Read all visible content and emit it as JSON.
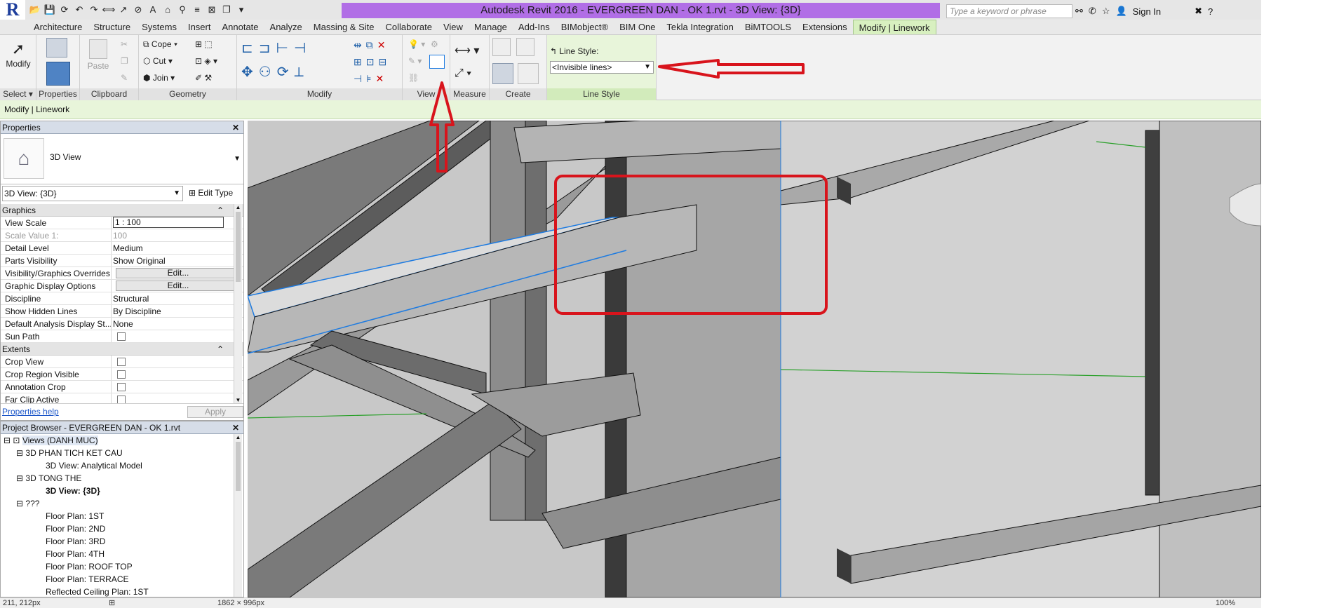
{
  "title": {
    "text": "Autodesk Revit 2016 -     EVERGREEN DAN - OK 1.rvt - 3D View: {3D}"
  },
  "search": {
    "placeholder": "Type a keyword or phrase"
  },
  "account": {
    "sign_in": "Sign In"
  },
  "tabs": [
    "Architecture",
    "Structure",
    "Systems",
    "Insert",
    "Annotate",
    "Analyze",
    "Massing & Site",
    "Collaborate",
    "View",
    "Manage",
    "Add-Ins",
    "BIMobject®",
    "BIM One",
    "Tekla Integration",
    "BiMTOOLS",
    "Extensions",
    "Modify | Linework"
  ],
  "ribbon": {
    "modify_label": "Modify",
    "paste_label": "Paste",
    "cope": "Cope",
    "cut": "Cut",
    "join": "Join",
    "line_style_label": "Line Style:",
    "line_style_value": "<Invisible lines>",
    "groups": {
      "select": "Select",
      "properties": "Properties",
      "clipboard": "Clipboard",
      "geometry": "Geometry",
      "modify": "Modify",
      "view": "View",
      "measure": "Measure",
      "create": "Create",
      "line_style": "Line Style"
    }
  },
  "context_label": "Modify | Linework",
  "properties": {
    "header": "Properties",
    "type_name": "3D View",
    "instance_dropdown": "3D View: {3D}",
    "edit_type": "Edit Type",
    "sections": {
      "graphics": "Graphics",
      "extents": "Extents"
    },
    "graphics_rows": [
      {
        "k": "View Scale",
        "v": "1 : 100"
      },
      {
        "k": "Scale Value    1:",
        "v": "100"
      },
      {
        "k": "Detail Level",
        "v": "Medium"
      },
      {
        "k": "Parts Visibility",
        "v": "Show Original"
      },
      {
        "k": "Visibility/Graphics Overrides",
        "v": "Edit..."
      },
      {
        "k": "Graphic Display Options",
        "v": "Edit..."
      },
      {
        "k": "Discipline",
        "v": "Structural"
      },
      {
        "k": "Show Hidden Lines",
        "v": "By Discipline"
      },
      {
        "k": "Default Analysis Display St...",
        "v": "None"
      },
      {
        "k": "Sun Path",
        "v": ""
      }
    ],
    "extents_rows": [
      {
        "k": "Crop View"
      },
      {
        "k": "Crop Region Visible"
      },
      {
        "k": "Annotation Crop"
      },
      {
        "k": "Far Clip Active"
      }
    ],
    "help": "Properties help",
    "apply": "Apply"
  },
  "browser": {
    "header": "Project Browser - EVERGREEN DAN - OK 1.rvt",
    "items": [
      {
        "label": "Views (DANH MUC)",
        "level": 0
      },
      {
        "label": "3D PHAN TICH KET CAU",
        "level": 1
      },
      {
        "label": "3D View: Analytical Model",
        "level": 2
      },
      {
        "label": "3D TONG THE",
        "level": 1
      },
      {
        "label": "3D View: {3D}",
        "level": 2
      },
      {
        "label": "???",
        "level": 1
      },
      {
        "label": "Floor Plan: 1ST",
        "level": 2
      },
      {
        "label": "Floor Plan: 2ND",
        "level": 2
      },
      {
        "label": "Floor Plan: 3RD",
        "level": 2
      },
      {
        "label": "Floor Plan: 4TH",
        "level": 2
      },
      {
        "label": "Floor Plan: ROOF TOP",
        "level": 2
      },
      {
        "label": "Floor Plan: TERRACE",
        "level": 2
      },
      {
        "label": "Reflected Ceiling Plan: 1ST",
        "level": 2
      }
    ]
  },
  "status": {
    "coords": "211, 212px",
    "size": "1862 × 996px",
    "zoom": "100%"
  },
  "colors": {
    "annotation_red": "#d8141c",
    "ribbon_green": "#d8f0c0",
    "title_purple": "#b16ee6",
    "selection_blue": "#1e7be0"
  }
}
